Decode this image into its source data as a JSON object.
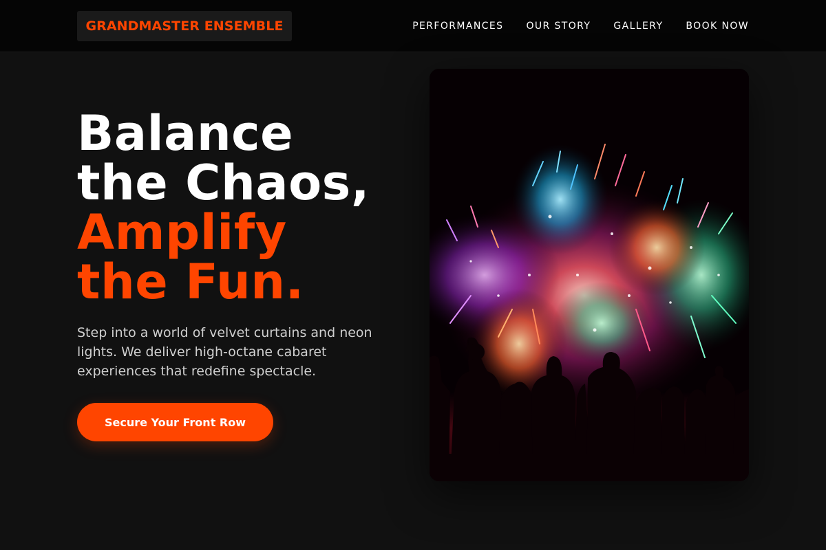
{
  "brand": {
    "logo_text": "GRANDMASTER ENSEMBLE",
    "accent_color": "#ff4500"
  },
  "nav": {
    "items": [
      {
        "label": "PERFORMANCES"
      },
      {
        "label": "OUR STORY"
      },
      {
        "label": "GALLERY"
      },
      {
        "label": "BOOK NOW"
      }
    ]
  },
  "hero": {
    "title_lines": [
      "Balance",
      "the Chaos,",
      "Amplify",
      "the Fun."
    ],
    "description": "Step into a world of velvet curtains and neon lights. We deliver high-octane cabaret experiences that redefine spectacle.",
    "cta_label": "Secure Your Front Row"
  },
  "image": {
    "subject": "fireworks-crowd-photo"
  }
}
